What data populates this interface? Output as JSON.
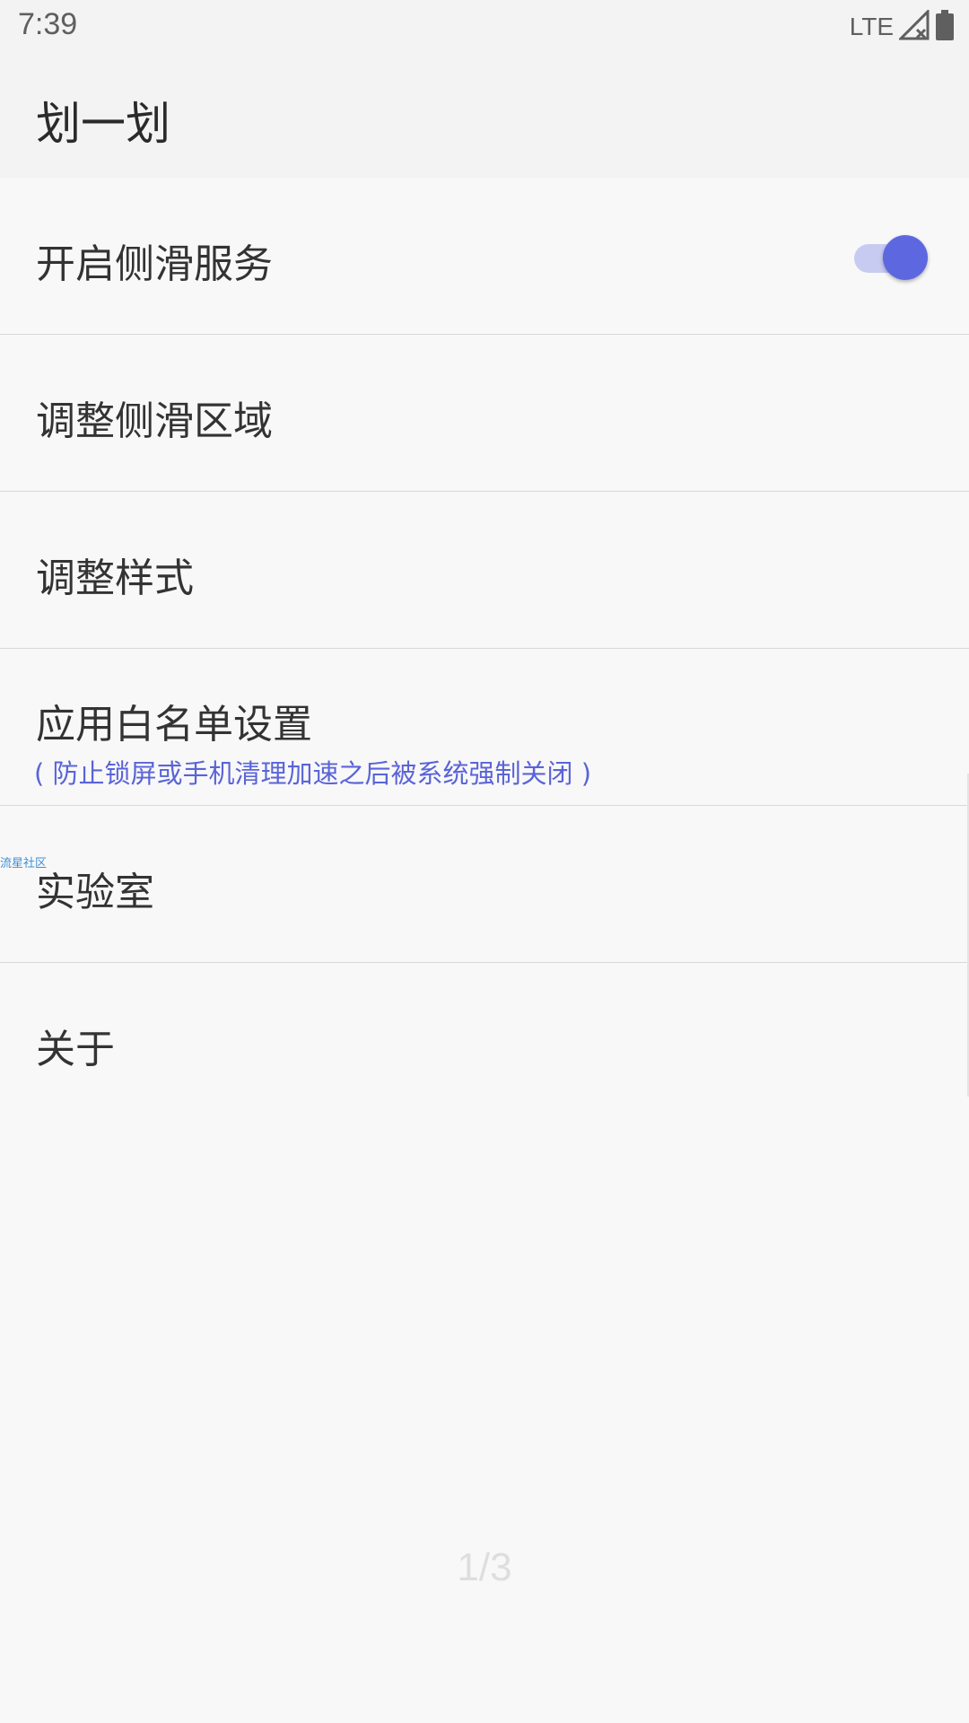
{
  "status_bar": {
    "time": "7:39",
    "network": "LTE",
    "icons": [
      "signal-no-service-icon",
      "battery-icon"
    ]
  },
  "app_bar": {
    "title": "划一划"
  },
  "settings": {
    "items": [
      {
        "label": "开启侧滑服务",
        "toggle": true
      },
      {
        "label": "调整侧滑区域"
      },
      {
        "label": "调整样式"
      },
      {
        "label": "应用白名单设置",
        "sub": "( 防止锁屏或手机清理加速之后被系统强制关闭 )"
      },
      {
        "label": "实验室"
      },
      {
        "label": "关于"
      }
    ]
  },
  "watermark": "流星社区",
  "pager": "1/3",
  "colors": {
    "accent": "#5d68e0",
    "toggle_track": "#c7cbf2",
    "sub_text": "#5a64d8",
    "background": "#f8f8f8",
    "bar_background": "#f3f3f3"
  }
}
